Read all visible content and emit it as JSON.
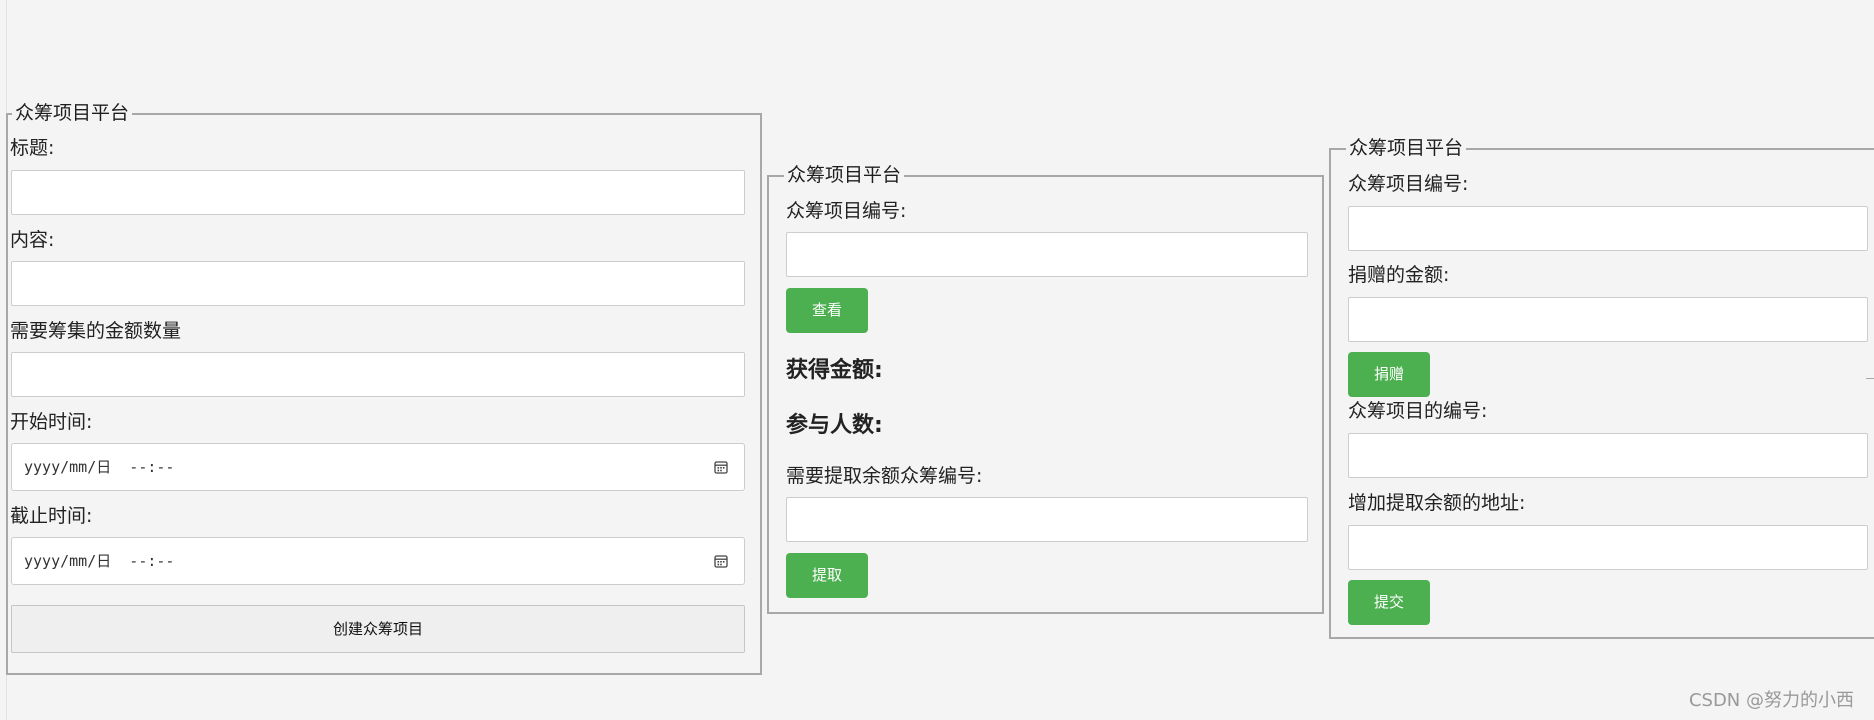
{
  "create_panel": {
    "title": "众筹项目平台",
    "title_label": "标题:",
    "content_label": "内容:",
    "amount_label": "需要筹集的金额数量",
    "start_label": "开始时间:",
    "start_placeholder": "yyyy/mm/日  --:--",
    "end_label": "截止时间:",
    "end_placeholder": "yyyy/mm/日  --:--",
    "create_button": "创建众筹项目"
  },
  "query_panel": {
    "title": "众筹项目平台",
    "project_id_label": "众筹项目编号:",
    "view_button": "查看",
    "raised_label": "获得金额:",
    "participants_label": "参与人数:",
    "withdraw_id_label": "需要提取余额众筹编号:",
    "withdraw_button": "提取"
  },
  "donate_panel": {
    "title": "众筹项目平台",
    "project_id_label": "众筹项目编号:",
    "donation_amount_label": "捐赠的金额:",
    "donate_button": "捐赠",
    "project_id_label_2": "众筹项目的编号:",
    "withdraw_address_label": "增加提取余额的地址:",
    "submit_button": "提交"
  },
  "watermark": "CSDN @努力的小西",
  "colors": {
    "background": "#f4f4f4",
    "button_green": "#4caf50",
    "panel_border": "#a8a8a8"
  },
  "icons": {
    "date_picker": "calendar-icon"
  }
}
